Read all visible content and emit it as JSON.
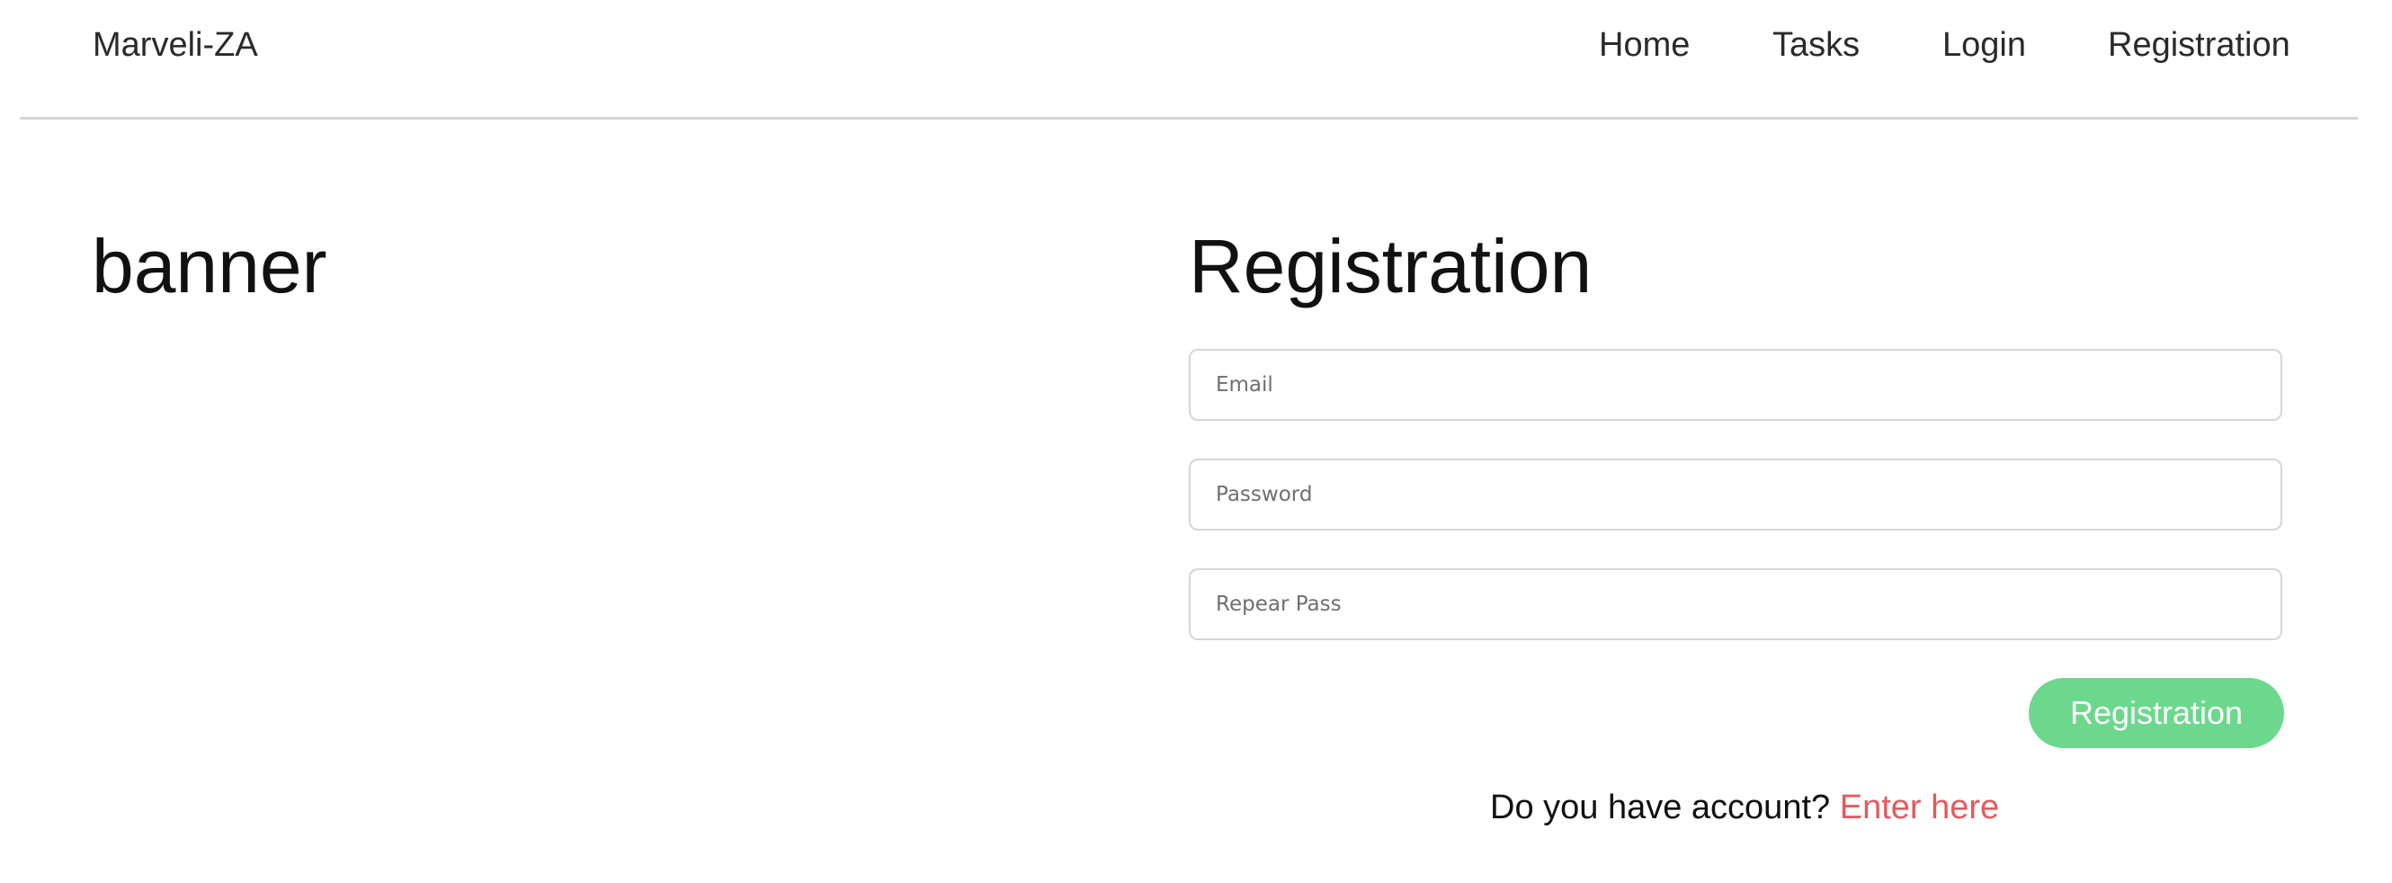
{
  "header": {
    "brand": "Marveli-ZA",
    "nav": {
      "home": "Home",
      "tasks": "Tasks",
      "login": "Login",
      "registration": "Registration"
    }
  },
  "main": {
    "banner_text": "banner",
    "form": {
      "title": "Registration",
      "email_placeholder": "Email",
      "password_placeholder": "Password",
      "repeat_placeholder": "Repear Pass",
      "submit_label": "Registration",
      "account_prompt": "Do you have account?",
      "enter_link": "Enter here"
    }
  },
  "colors": {
    "submit_button": "#6cd88d",
    "link": "#e45a5e",
    "divider": "#d4d4d4"
  }
}
